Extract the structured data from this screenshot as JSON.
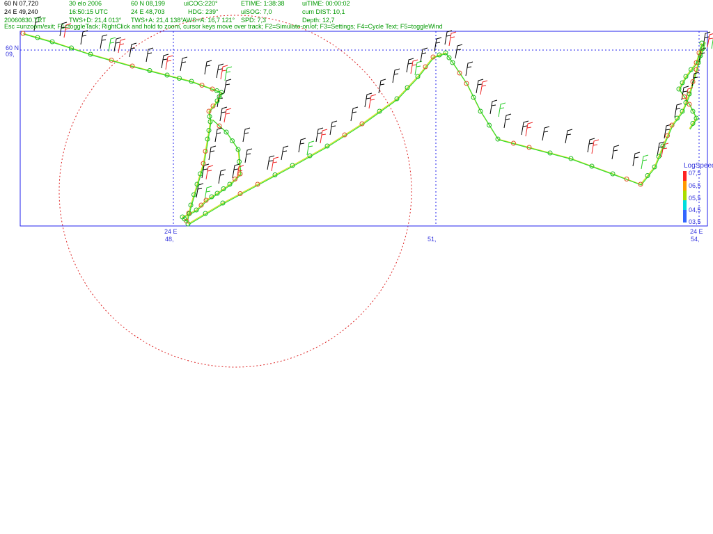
{
  "colors": {
    "frame": "#2222ee",
    "info_green": "#009900",
    "circle": "#dd2222",
    "track_green": "#33dd33",
    "track_yellow": "#dddd22",
    "wind_black": "#000000",
    "wind_red": "#ee2222",
    "wind_green": "#22cc22"
  },
  "info": {
    "col1": {
      "lat": "60 N 07,720",
      "lon": "24 E 49,240",
      "file": "20060830.TRT"
    },
    "col2": {
      "date": "30 elo 2006",
      "time": "16:50:15  UTC",
      "twsd": "TWS+D: 21,4 013°"
    },
    "col3": {
      "lat": "60 N 08,199",
      "lon": "24 E 48,703",
      "twsa": "TWS+A: 21,4 138°"
    },
    "col4": {
      "cog": "uiCOG:220°",
      "hdg": "HDG: 239°",
      "awsa": "AWS+A: 16,7 121°"
    },
    "col5": {
      "etime": "ETIME: 1:38:38",
      "sog": "uiSOG: 7,0",
      "spd": "SPD: 7,3"
    },
    "col6": {
      "uitime": "uiTIME: 00:00:02",
      "dist": "cum DIST: 10,1",
      "depth": "Depth: 12,7"
    },
    "help": "Esc =unzoom/exit; F1=toggleTack; RightClick and hold to zoom, cursor keys move over track; F2=Simulate-on/of; F3=Settings; F4=Cycle Text; F5=toggleWind"
  },
  "axes": {
    "lat_label": "60 N",
    "lat_min": "09,",
    "lon_labels": [
      {
        "deg": "24 E",
        "min": "48,"
      },
      {
        "deg": "",
        "min": "51,"
      },
      {
        "deg": "24 E",
        "min": "54,"
      }
    ]
  },
  "legend": {
    "title": "LogSpeed",
    "items": [
      {
        "label": "07,5",
        "color": "#ff2222"
      },
      {
        "label": "06,5",
        "color": "#ff9900"
      },
      {
        "label": "05,5",
        "color": "#aadd00"
      },
      {
        "label": "04,5",
        "color": "#00dddd"
      },
      {
        "label": "03,5",
        "color": "#3366ff"
      }
    ]
  }
}
